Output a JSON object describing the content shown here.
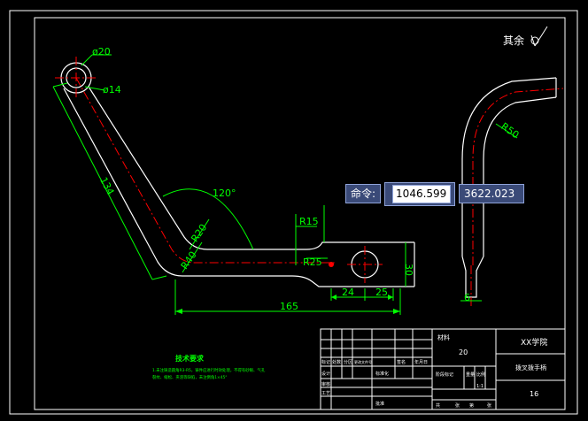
{
  "drawing": {
    "dims": {
      "d20": "ø20",
      "d14": "ø14",
      "len134": "134",
      "ang120": "120°",
      "r20": "R20",
      "r40": "R40",
      "r15": "R15",
      "r25": "R25",
      "w165": "165",
      "w24": "24",
      "w25": "25",
      "h30": "30",
      "r50": "R50",
      "w6": "6"
    },
    "roughness": "其余",
    "notes_title": "技术要求",
    "notes_lines": [
      "1.未注铸造圆角R3-R5，铸件应进行时效处理，不得有砂眼、气孔",
      "裂纹、缩松、夹渣等缺陷，未注倒角1×45°"
    ]
  },
  "title_block": {
    "material_label": "材料",
    "material_value": "20",
    "school": "XX学院",
    "part_name": "拨叉拨手柄",
    "drawing_no": "16",
    "scale": "1:1",
    "row_labels": [
      "标记",
      "处数",
      "分区",
      "更改文件号",
      "签名",
      "年月日"
    ],
    "design": "设计",
    "standard": "标准化",
    "stage_mark": "阶段标记",
    "weight": "重量",
    "ratio": "比例",
    "check": "审核",
    "craft": "工艺",
    "approve": "批准",
    "sheets_total": "共",
    "sheet": "张",
    "sheet_no": "第",
    "sheet_of": "张"
  },
  "command": {
    "label": "命令:",
    "x_value": "1046.599",
    "y_value": "3622.023"
  },
  "colors": {
    "outline": "#ffffff",
    "centerline": "#ff0000",
    "dimension": "#00ff00",
    "command_bg": "#3a4a78"
  }
}
